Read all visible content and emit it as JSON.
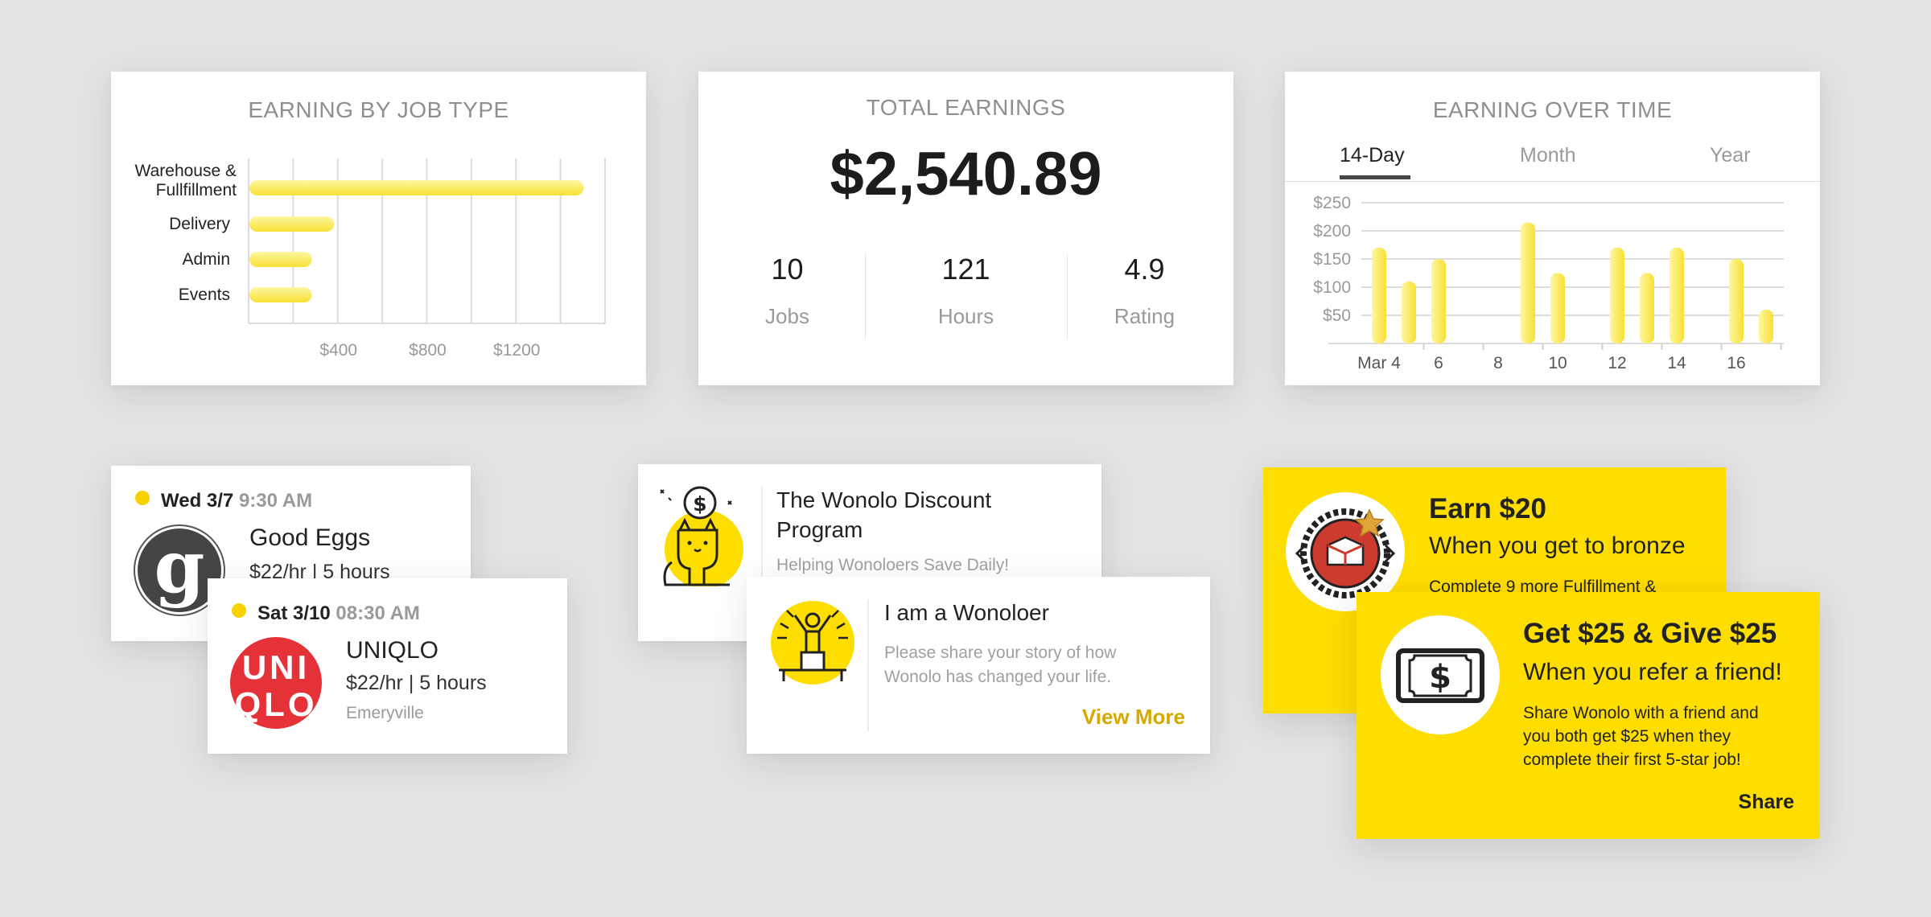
{
  "earning_by_job_type": {
    "title": "EARNING BY JOB TYPE"
  },
  "total_earnings": {
    "title": "TOTAL EARNINGS",
    "amount": "$2,540.89",
    "stats": [
      {
        "value": "10",
        "label": "Jobs"
      },
      {
        "value": "121",
        "label": "Hours"
      },
      {
        "value": "4.9",
        "label": "Rating"
      }
    ]
  },
  "earning_over_time": {
    "title": "EARNING OVER TIME",
    "tabs": [
      {
        "label": "14-Day",
        "active": true
      },
      {
        "label": "Month",
        "active": false
      },
      {
        "label": "Year",
        "active": false
      }
    ]
  },
  "chart_data": [
    {
      "type": "bar",
      "orientation": "horizontal",
      "title": "EARNING BY JOB TYPE",
      "categories": [
        "Warehouse & Fullfillment",
        "Delivery",
        "Admin",
        "Events"
      ],
      "values": [
        1500,
        380,
        280,
        280
      ],
      "xticks": [
        "$400",
        "$800",
        "$1200"
      ],
      "xlim": [
        0,
        1600
      ],
      "grid": true,
      "color": "#f7e135"
    },
    {
      "type": "bar",
      "title": "EARNING OVER TIME",
      "xticklabels": [
        "Mar 4",
        "6",
        "8",
        "10",
        "12",
        "14",
        "16"
      ],
      "yticks": [
        "$250",
        "$200",
        "$150",
        "$100",
        "$50"
      ],
      "ylim": [
        0,
        250
      ],
      "grid": true,
      "color": "#f7e135",
      "series": [
        {
          "days": [
            4,
            5,
            6,
            7,
            8,
            9,
            10,
            11,
            12,
            13,
            14,
            15,
            16,
            17
          ],
          "values": [
            170,
            110,
            150,
            0,
            0,
            215,
            125,
            0,
            170,
            125,
            170,
            0,
            150,
            60
          ]
        }
      ]
    }
  ],
  "jobs": [
    {
      "day": "Wed 3/7",
      "time": "9:30 AM",
      "name": "Good Eggs",
      "pay": "$22/hr | 5 hours",
      "location": "",
      "logo_letter": "g"
    },
    {
      "day": "Sat 3/10",
      "time": "08:30 AM",
      "name": "UNIQLO",
      "pay": "$22/hr | 5 hours",
      "location": "Emeryville",
      "logo_text": [
        "UNI",
        "QLO"
      ]
    }
  ],
  "programs": [
    {
      "title_line1": "The Wonolo Discount",
      "title_line2": "Program",
      "subtitle": "Helping Wonoloers Save Daily!",
      "icon": "cat-coin-icon"
    },
    {
      "title": "I am a Wonoloer",
      "sub_line1": "Please share your story of how",
      "sub_line2": "Wonolo has changed your life.",
      "action": "View More",
      "icon": "person-podium-icon"
    }
  ],
  "promos": [
    {
      "headline": "Earn $20",
      "subhead": "When you get to bronze",
      "text": "Complete 9 more Fulfillment &",
      "icon": "bronze-badge-icon"
    },
    {
      "headline": "Get $25 & Give $25",
      "subhead": "When you refer a friend!",
      "text_line1": "Share Wonolo with a friend and",
      "text_line2": "you both get $25 when they",
      "text_line3": "complete their first 5-star job!",
      "action": "Share",
      "icon": "dollar-bill-icon"
    }
  ],
  "colors": {
    "accent": "#fedd00",
    "bar": "#f7e135",
    "link": "#d7a900",
    "uniqlo": "#e53238"
  }
}
